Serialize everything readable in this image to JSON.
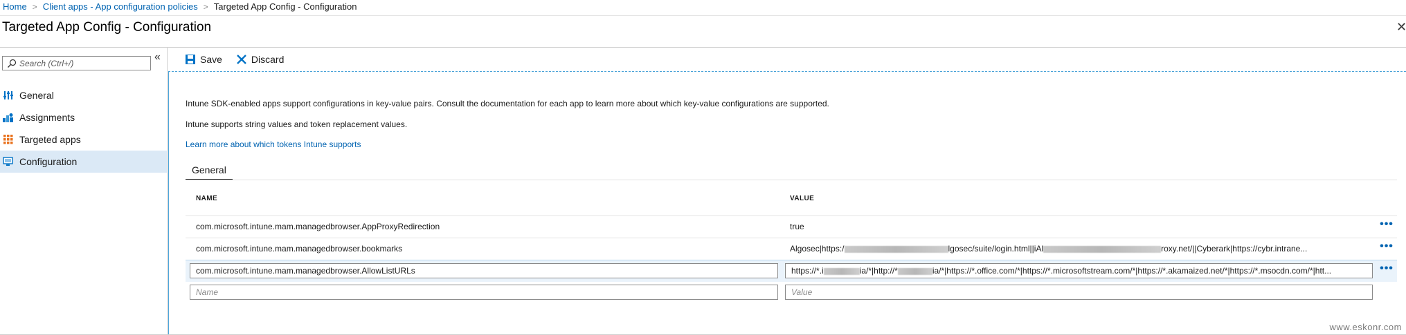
{
  "breadcrumb": {
    "items": [
      "Home",
      "Client apps - App configuration policies"
    ],
    "separator": ">",
    "current": "Targeted App Config - Configuration"
  },
  "header": {
    "title": "Targeted App Config - Configuration",
    "close": "✕"
  },
  "sidebar": {
    "search_placeholder": "Search (Ctrl+/)",
    "collapse": "«",
    "items": [
      {
        "label": "General",
        "icon": "bars-icon",
        "active": false
      },
      {
        "label": "Assignments",
        "icon": "people-icon",
        "active": false
      },
      {
        "label": "Targeted apps",
        "icon": "grid-icon",
        "active": false
      },
      {
        "label": "Configuration",
        "icon": "monitor-icon",
        "active": true
      }
    ]
  },
  "toolbar": {
    "save_label": "Save",
    "discard_label": "Discard"
  },
  "main": {
    "desc1": "Intune SDK-enabled apps support configurations in key-value pairs. Consult the documentation for each app to learn more about which key-value configurations are supported.",
    "desc2": "Intune supports string values and token replacement values.",
    "learn_link": "Learn more about which tokens Intune supports",
    "tab": "General",
    "table": {
      "col_name": "NAME",
      "col_value": "VALUE",
      "rows": [
        {
          "name": "com.microsoft.intune.mam.managedbrowser.AppProxyRedirection",
          "value": "true"
        },
        {
          "name": "com.microsoft.intune.mam.managedbrowser.bookmarks",
          "value_a": "Algosec|https:/",
          "value_b": "lgosec/suite/login.html||iAl",
          "value_c": "roxy.net/||Cyberark|https://cybr.intrane..."
        },
        {
          "name": "com.microsoft.intune.mam.managedbrowser.AllowListURLs",
          "value_a": "https://*.i",
          "value_b": "ia/*|http://*",
          "value_c": "ia/*|https://*.office.com/*|https://*.microsoftstream.com/*|https://*.akamaized.net/*|https://*.msocdn.com/*|htt..."
        }
      ],
      "new_row": {
        "name_placeholder": "Name",
        "value_placeholder": "Value"
      },
      "more": "•••"
    }
  },
  "watermark": "www.eskonr.com",
  "colors": {
    "accent": "#0063b1",
    "active_bg": "#dbe9f6",
    "focus_line": "#4aa3d8"
  }
}
